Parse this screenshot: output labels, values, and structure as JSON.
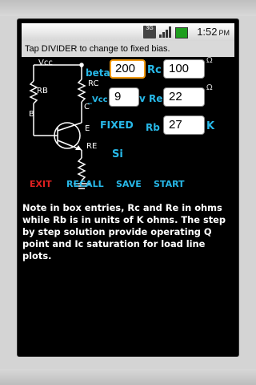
{
  "status": {
    "network": "3G",
    "time": "1:52",
    "ampm": "PM"
  },
  "banner": "Tap DIVIDER to change to fixed bias.",
  "circuit": {
    "vcc": "Vcc",
    "rb": "RB",
    "rc": "RC",
    "re": "RE",
    "b": "B",
    "c": "C",
    "e": "E"
  },
  "fields": {
    "beta_label": "beta",
    "beta_value": "200",
    "rc_label": "Rc",
    "rc_value": "100",
    "vcc_label": "_Vcc",
    "vcc_value": "9",
    "re_label": "v Re",
    "re_value": "22",
    "rb_label": "Rb",
    "rb_value": "27",
    "rb_unit": "K",
    "ohm": "Ω"
  },
  "fixed_label": "FIXED",
  "si_label": "Si",
  "buttons": {
    "exit": "EXIT",
    "recall": "RECALL",
    "save": "SAVE",
    "start": "START"
  },
  "note": "Note in box entries, Rc and Re in ohms while Rb is in units of K ohms. The step by step solution provide operating Q point and Ic saturation for load line plots.",
  "colors": {
    "accent": "#27b8e8",
    "exit": "#e02020",
    "focus": "#f39c12"
  }
}
